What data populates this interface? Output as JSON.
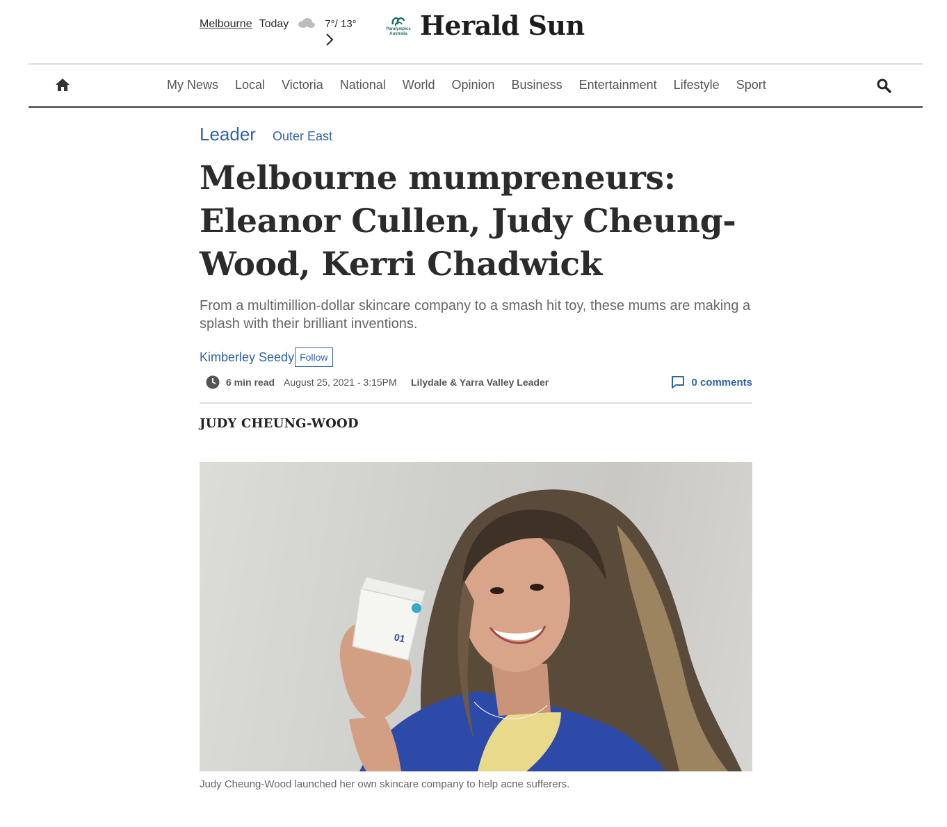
{
  "weather": {
    "city": "Melbourne",
    "day": "Today",
    "temps": "7°/ 13°",
    "icon": "cloud-icon"
  },
  "brand": {
    "logo_text": "Paralympics Australia",
    "title": "Herald Sun"
  },
  "nav": {
    "items": [
      "My News",
      "Local",
      "Victoria",
      "National",
      "World",
      "Opinion",
      "Business",
      "Entertainment",
      "Lifestyle",
      "Sport"
    ]
  },
  "article": {
    "section": "Leader",
    "subsection": "Outer East",
    "headline": "Melbourne mumpreneurs: Eleanor Cullen, Judy Cheung-Wood, Kerri Chadwick",
    "standfirst": "From a multimillion-dollar skincare company to a smash hit toy, these mums are making a splash with their brilliant inventions.",
    "author": "Kimberley Seedy",
    "follow_label": "Follow",
    "read_time": "6 min read",
    "date": "August 25, 2021 - 3:15PM",
    "publication": "Lilydale & Yarra Valley Leader",
    "comments": "0 comments",
    "subhead": "JUDY CHEUNG-WOOD",
    "caption": "Judy Cheung-Wood launched her own skincare company to help acne sufferers.",
    "jar_label": "01"
  },
  "colors": {
    "link_blue": "#2f63a8",
    "brand_green": "#1b6f63",
    "text_dark": "#2b2b2b"
  }
}
